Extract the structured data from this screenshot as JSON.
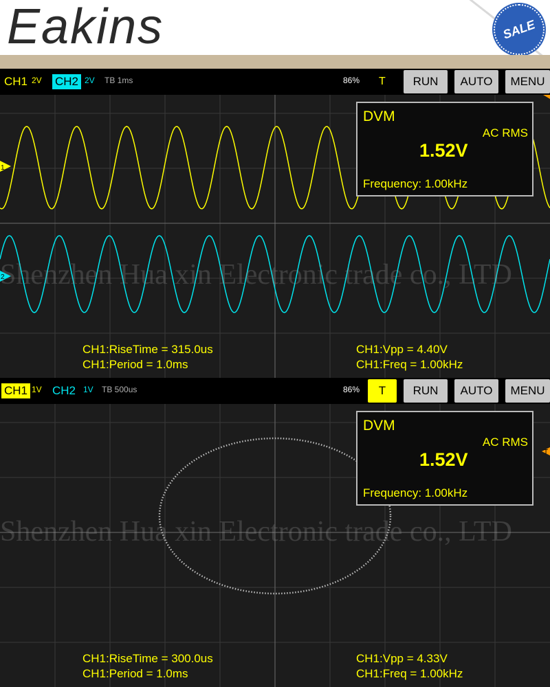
{
  "banner": {
    "brand": "Eakins",
    "seal": "SALE"
  },
  "watermark": "Shenzhen Hua xin Electronic trade co., LTD",
  "scope1": {
    "ch1": {
      "label": "CH1",
      "scale": "2V"
    },
    "ch2": {
      "label": "CH2",
      "scale": "2V"
    },
    "timebase": "TB 1ms",
    "battery": "86%",
    "trigger": "T",
    "buttons": {
      "run": "RUN",
      "auto": "AUTO",
      "menu": "MENU"
    },
    "dvm": {
      "title": "DVM",
      "mode": "AC RMS",
      "value": "1.52V",
      "frequency": "Frequency: 1.00kHz"
    },
    "markers": {
      "ch1": "1",
      "ch2": "2"
    },
    "measurements": {
      "rise": "CH1:RiseTime = 315.0us",
      "period": "CH1:Period = 1.0ms",
      "vpp": "CH1:Vpp = 4.40V",
      "freq": "CH1:Freq = 1.00kHz"
    }
  },
  "scope2": {
    "ch1": {
      "label": "CH1",
      "scale": "1V"
    },
    "ch2": {
      "label": "CH2",
      "scale": "1V"
    },
    "timebase": "TB 500us",
    "battery": "86%",
    "trigger": "T",
    "buttons": {
      "run": "RUN",
      "auto": "AUTO",
      "menu": "MENU"
    },
    "dvm": {
      "title": "DVM",
      "mode": "AC RMS",
      "value": "1.52V",
      "frequency": "Frequency: 1.00kHz"
    },
    "markers": {
      "trigger": "T"
    },
    "measurements": {
      "rise": "CH1:RiseTime = 300.0us",
      "period": "CH1:Period = 1.0ms",
      "vpp": "CH1:Vpp = 4.33V",
      "freq": "CH1:Freq = 1.00kHz"
    }
  },
  "colors": {
    "ch1": "#ffff00",
    "ch2": "#00e5ee",
    "grid": "#3a3a3a",
    "toolbar": "#000000"
  },
  "chart_data": [
    {
      "type": "line",
      "series": [
        {
          "name": "CH1",
          "waveform": "sine",
          "cycles_visible": 11
        },
        {
          "name": "CH2",
          "waveform": "sine",
          "cycles_visible": 11
        }
      ]
    },
    {
      "type": "scatter",
      "series": [
        {
          "name": "XY",
          "shape": "ellipse"
        }
      ]
    }
  ]
}
